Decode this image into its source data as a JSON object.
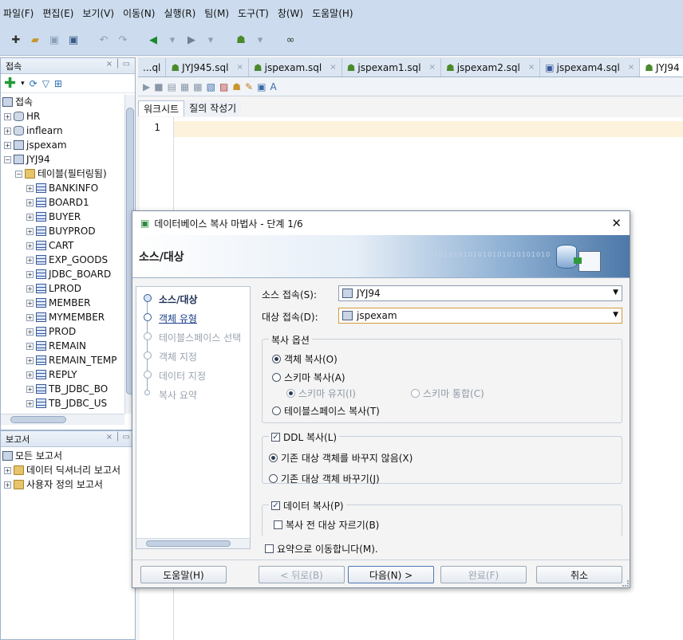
{
  "menu": [
    "파일(F)",
    "편집(E)",
    "보기(V)",
    "이동(N)",
    "실행(R)",
    "팀(M)",
    "도구(T)",
    "창(W)",
    "도움말(H)"
  ],
  "connections_panel": {
    "title": "접속",
    "tree": [
      {
        "label": "접속",
        "kind": "root",
        "level": 0
      },
      {
        "label": "HR",
        "kind": "db",
        "level": 1
      },
      {
        "label": "inflearn",
        "kind": "db",
        "level": 1
      },
      {
        "label": "jspexam",
        "kind": "conn",
        "level": 1
      },
      {
        "label": "JYJ94",
        "kind": "conn",
        "level": 1
      },
      {
        "label": "테이블(필터링됨)",
        "kind": "folder",
        "level": 2
      },
      {
        "label": "BANKINFO",
        "kind": "table",
        "level": 3
      },
      {
        "label": "BOARD1",
        "kind": "table",
        "level": 3
      },
      {
        "label": "BUYER",
        "kind": "table",
        "level": 3
      },
      {
        "label": "BUYPROD",
        "kind": "table",
        "level": 3
      },
      {
        "label": "CART",
        "kind": "table",
        "level": 3
      },
      {
        "label": "EXP_GOODS",
        "kind": "table",
        "level": 3
      },
      {
        "label": "JDBC_BOARD",
        "kind": "table",
        "level": 3
      },
      {
        "label": "LPROD",
        "kind": "table",
        "level": 3
      },
      {
        "label": "MEMBER",
        "kind": "table",
        "level": 3
      },
      {
        "label": "MYMEMBER",
        "kind": "table",
        "level": 3
      },
      {
        "label": "PROD",
        "kind": "table",
        "level": 3
      },
      {
        "label": "REMAIN",
        "kind": "table",
        "level": 3
      },
      {
        "label": "REMAIN_TEMP",
        "kind": "table",
        "level": 3
      },
      {
        "label": "REPLY",
        "kind": "table",
        "level": 3
      },
      {
        "label": "TB_JDBC_BO",
        "kind": "table",
        "level": 3
      },
      {
        "label": "TB_JDBC_US",
        "kind": "table",
        "level": 3
      }
    ]
  },
  "reports_panel": {
    "title": "보고서",
    "tree": [
      {
        "label": "모든 보고서",
        "kind": "root",
        "level": 0
      },
      {
        "label": "데이터 딕셔너리 보고서",
        "kind": "folder",
        "level": 1
      },
      {
        "label": "사용자 정의 보고서",
        "kind": "folder",
        "level": 1
      }
    ]
  },
  "editor": {
    "tabs": [
      "...ql",
      "JYJ945.sql",
      "jspexam.sql",
      "jspexam1.sql",
      "jspexam2.sql",
      "jspexam4.sql",
      "JYJ94"
    ],
    "subtabs": [
      "워크시트",
      "질의 작성기"
    ],
    "line_number": "1"
  },
  "dialog": {
    "title": "데이터베이스 복사 마법사 - 단계 1/6",
    "header": "소스/대상",
    "header_binary": "0101010101010101010101010",
    "steps": [
      {
        "label": "소스/대상",
        "state": "current"
      },
      {
        "label": "객체 유형",
        "state": "link"
      },
      {
        "label": "테이블스페이스 선택",
        "state": "disabled"
      },
      {
        "label": "객체 지정",
        "state": "disabled"
      },
      {
        "label": "데이터 지정",
        "state": "disabled"
      },
      {
        "label": "복사 요약",
        "state": "disabled"
      }
    ],
    "source_label": "소스 접속(S):",
    "source_value": "JYJ94",
    "target_label": "대상 접속(D):",
    "target_value": "jspexam",
    "copy_options": {
      "title": "복사 옵션",
      "copy_objects": "객체 복사(O)",
      "copy_schema": "스키마 복사(A)",
      "keep_schema": "스키마 유지(I)",
      "merge_schema": "스키마 통합(C)",
      "copy_tablespace": "테이블스페이스 복사(T)"
    },
    "ddl": {
      "title": "DDL 복사(L)",
      "no_replace": "기존 대상 객체를 바꾸지 않음(X)",
      "replace": "기존 대상 객체 바꾸기(J)"
    },
    "data": {
      "title": "데이터 복사(P)",
      "truncate": "복사 전 대상 자르기(B)"
    },
    "go_summary": "요약으로 이동합니다(M).",
    "buttons": {
      "help": "도움말(H)",
      "back": "< 뒤로(B)",
      "next": "다음(N) >",
      "finish": "완료(F)",
      "cancel": "취소"
    }
  }
}
